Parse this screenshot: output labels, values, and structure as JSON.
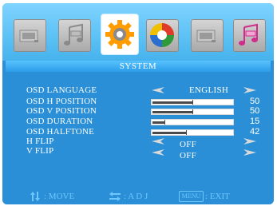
{
  "tabs": [
    {
      "name": "picture",
      "icon": "picture-icon"
    },
    {
      "name": "audio",
      "icon": "music-note-icon"
    },
    {
      "name": "system",
      "icon": "gear-icon",
      "active": true
    },
    {
      "name": "color",
      "icon": "color-wheel-icon"
    },
    {
      "name": "picture-2",
      "icon": "picture-icon"
    },
    {
      "name": "audio-2",
      "icon": "music-note-icon"
    }
  ],
  "panel": {
    "title": "SYSTEM"
  },
  "settings": [
    {
      "label": "OSD LANGUAGE",
      "value": "ENGLISH"
    },
    {
      "label": "OSD H POSITION",
      "value": "50",
      "level": 0.5
    },
    {
      "label": "OSD V POSITION",
      "value": "50",
      "level": 0.5
    },
    {
      "label": "OSD DURATION",
      "value": "15",
      "level": 0.15
    },
    {
      "label": "OSD HALFTONE",
      "value": "42",
      "level": 0.42
    },
    {
      "label": "H FLIP",
      "value": "OFF"
    },
    {
      "label": "V FLIP",
      "value": "OFF"
    }
  ],
  "footer": {
    "move": ": MOVE",
    "adj": ": A D J",
    "menu_key": "MENU",
    "exit": ": EXIT"
  },
  "colors": {
    "osd_background": "#2a8fd6",
    "tabbar": "#5cc1f4",
    "footer_text": "#6fc7ff"
  }
}
